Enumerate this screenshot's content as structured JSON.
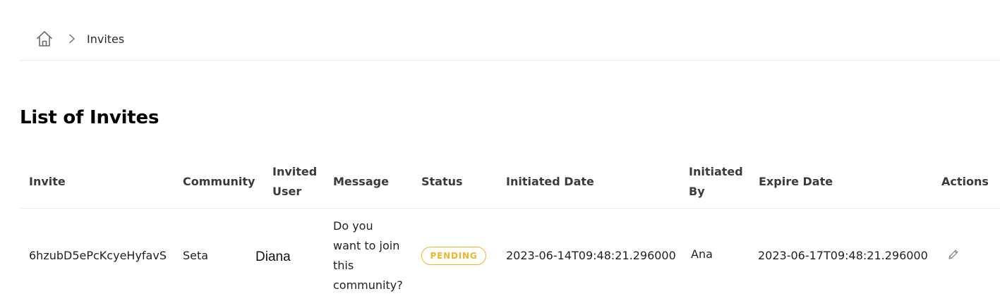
{
  "breadcrumb": {
    "home_icon": "home-icon",
    "separator_icon": "chevron-right-icon",
    "current": "Invites"
  },
  "page": {
    "title": "List of Invites"
  },
  "table": {
    "columns": {
      "invite": "Invite",
      "community": "Community",
      "invited_user_1": "Invited",
      "invited_user_2": "User",
      "message": "Message",
      "status": "Status",
      "initiated_date": "Initiated Date",
      "initiated_by_1": "Initiated",
      "initiated_by_2": "By",
      "expire_date": "Expire Date",
      "actions": "Actions"
    },
    "rows": [
      {
        "invite": "6hzubD5ePcKcyeHyfavS",
        "community": "Seta",
        "invited_user": "Diana",
        "message_lines": [
          "Do you",
          "want to join",
          "this",
          "community?"
        ],
        "status": "PENDING",
        "initiated_date": "2023-06-14T09:48:21.296000",
        "initiated_by": "Ana",
        "expire_date": "2023-06-17T09:48:21.296000",
        "action_icon": "edit-icon"
      }
    ]
  },
  "colors": {
    "status_pending": "#f0b429",
    "divider": "#ececec",
    "header_text": "#3a3a3a"
  }
}
